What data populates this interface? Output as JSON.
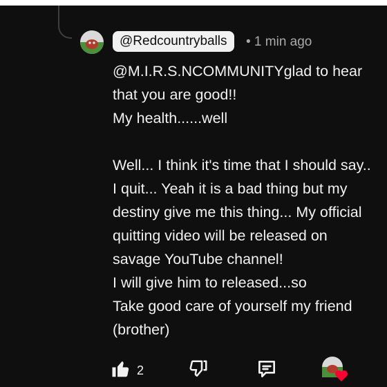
{
  "comment": {
    "author": "@Redcountryballs",
    "meta": "• 1 min ago",
    "lines": [
      "@M.I.R.S.NCOMMUNITYglad to hear",
      "that you are good!!",
      "My health......well",
      "",
      "Well... I think it's time that I should say..",
      "I quit... Yeah it is a bad thing but my",
      "destiny give me this thing... My official",
      "quitting video will be released on",
      "savage YouTube channel!",
      "I will give him to released...so",
      "Take good care of yourself my friend",
      "(brother)"
    ]
  },
  "actions": {
    "like_count": "2",
    "icons": [
      "thumbs-up-icon",
      "thumbs-down-icon",
      "reply-icon",
      "creator-heart-icon"
    ]
  },
  "colors": {
    "background": "#0f0f0f",
    "text": "#f1f1f1",
    "secondary_text": "#aaaaaa",
    "author_chip": "#f1f1f1",
    "heart": "#ff0033"
  }
}
